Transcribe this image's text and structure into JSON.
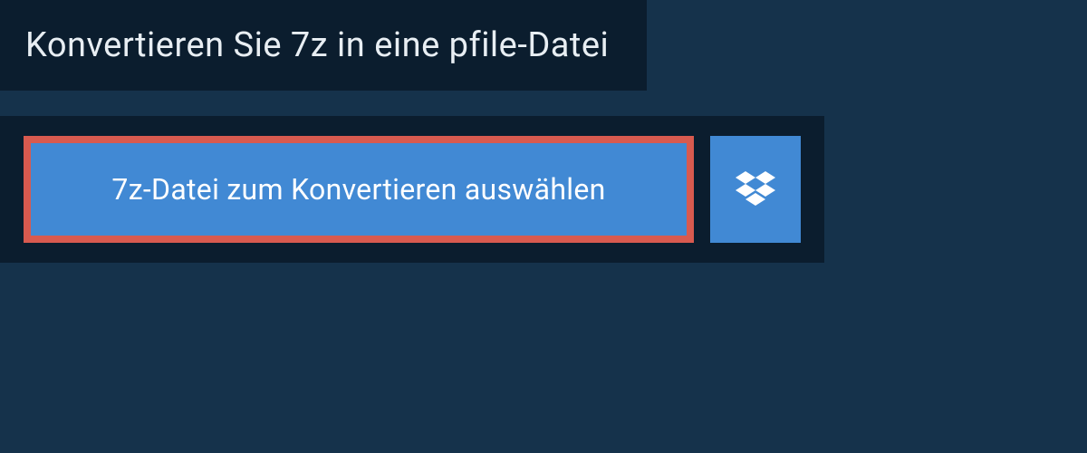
{
  "header": {
    "title": "Konvertieren Sie 7z in eine pfile-Datei"
  },
  "upload": {
    "select_file_label": "7z-Datei zum Konvertieren auswählen"
  },
  "colors": {
    "page_bg": "#15324b",
    "panel_bg": "#0b1d2e",
    "button_bg": "#4189d4",
    "highlight_border": "#d85a4f",
    "text_light": "#e8eef3"
  }
}
